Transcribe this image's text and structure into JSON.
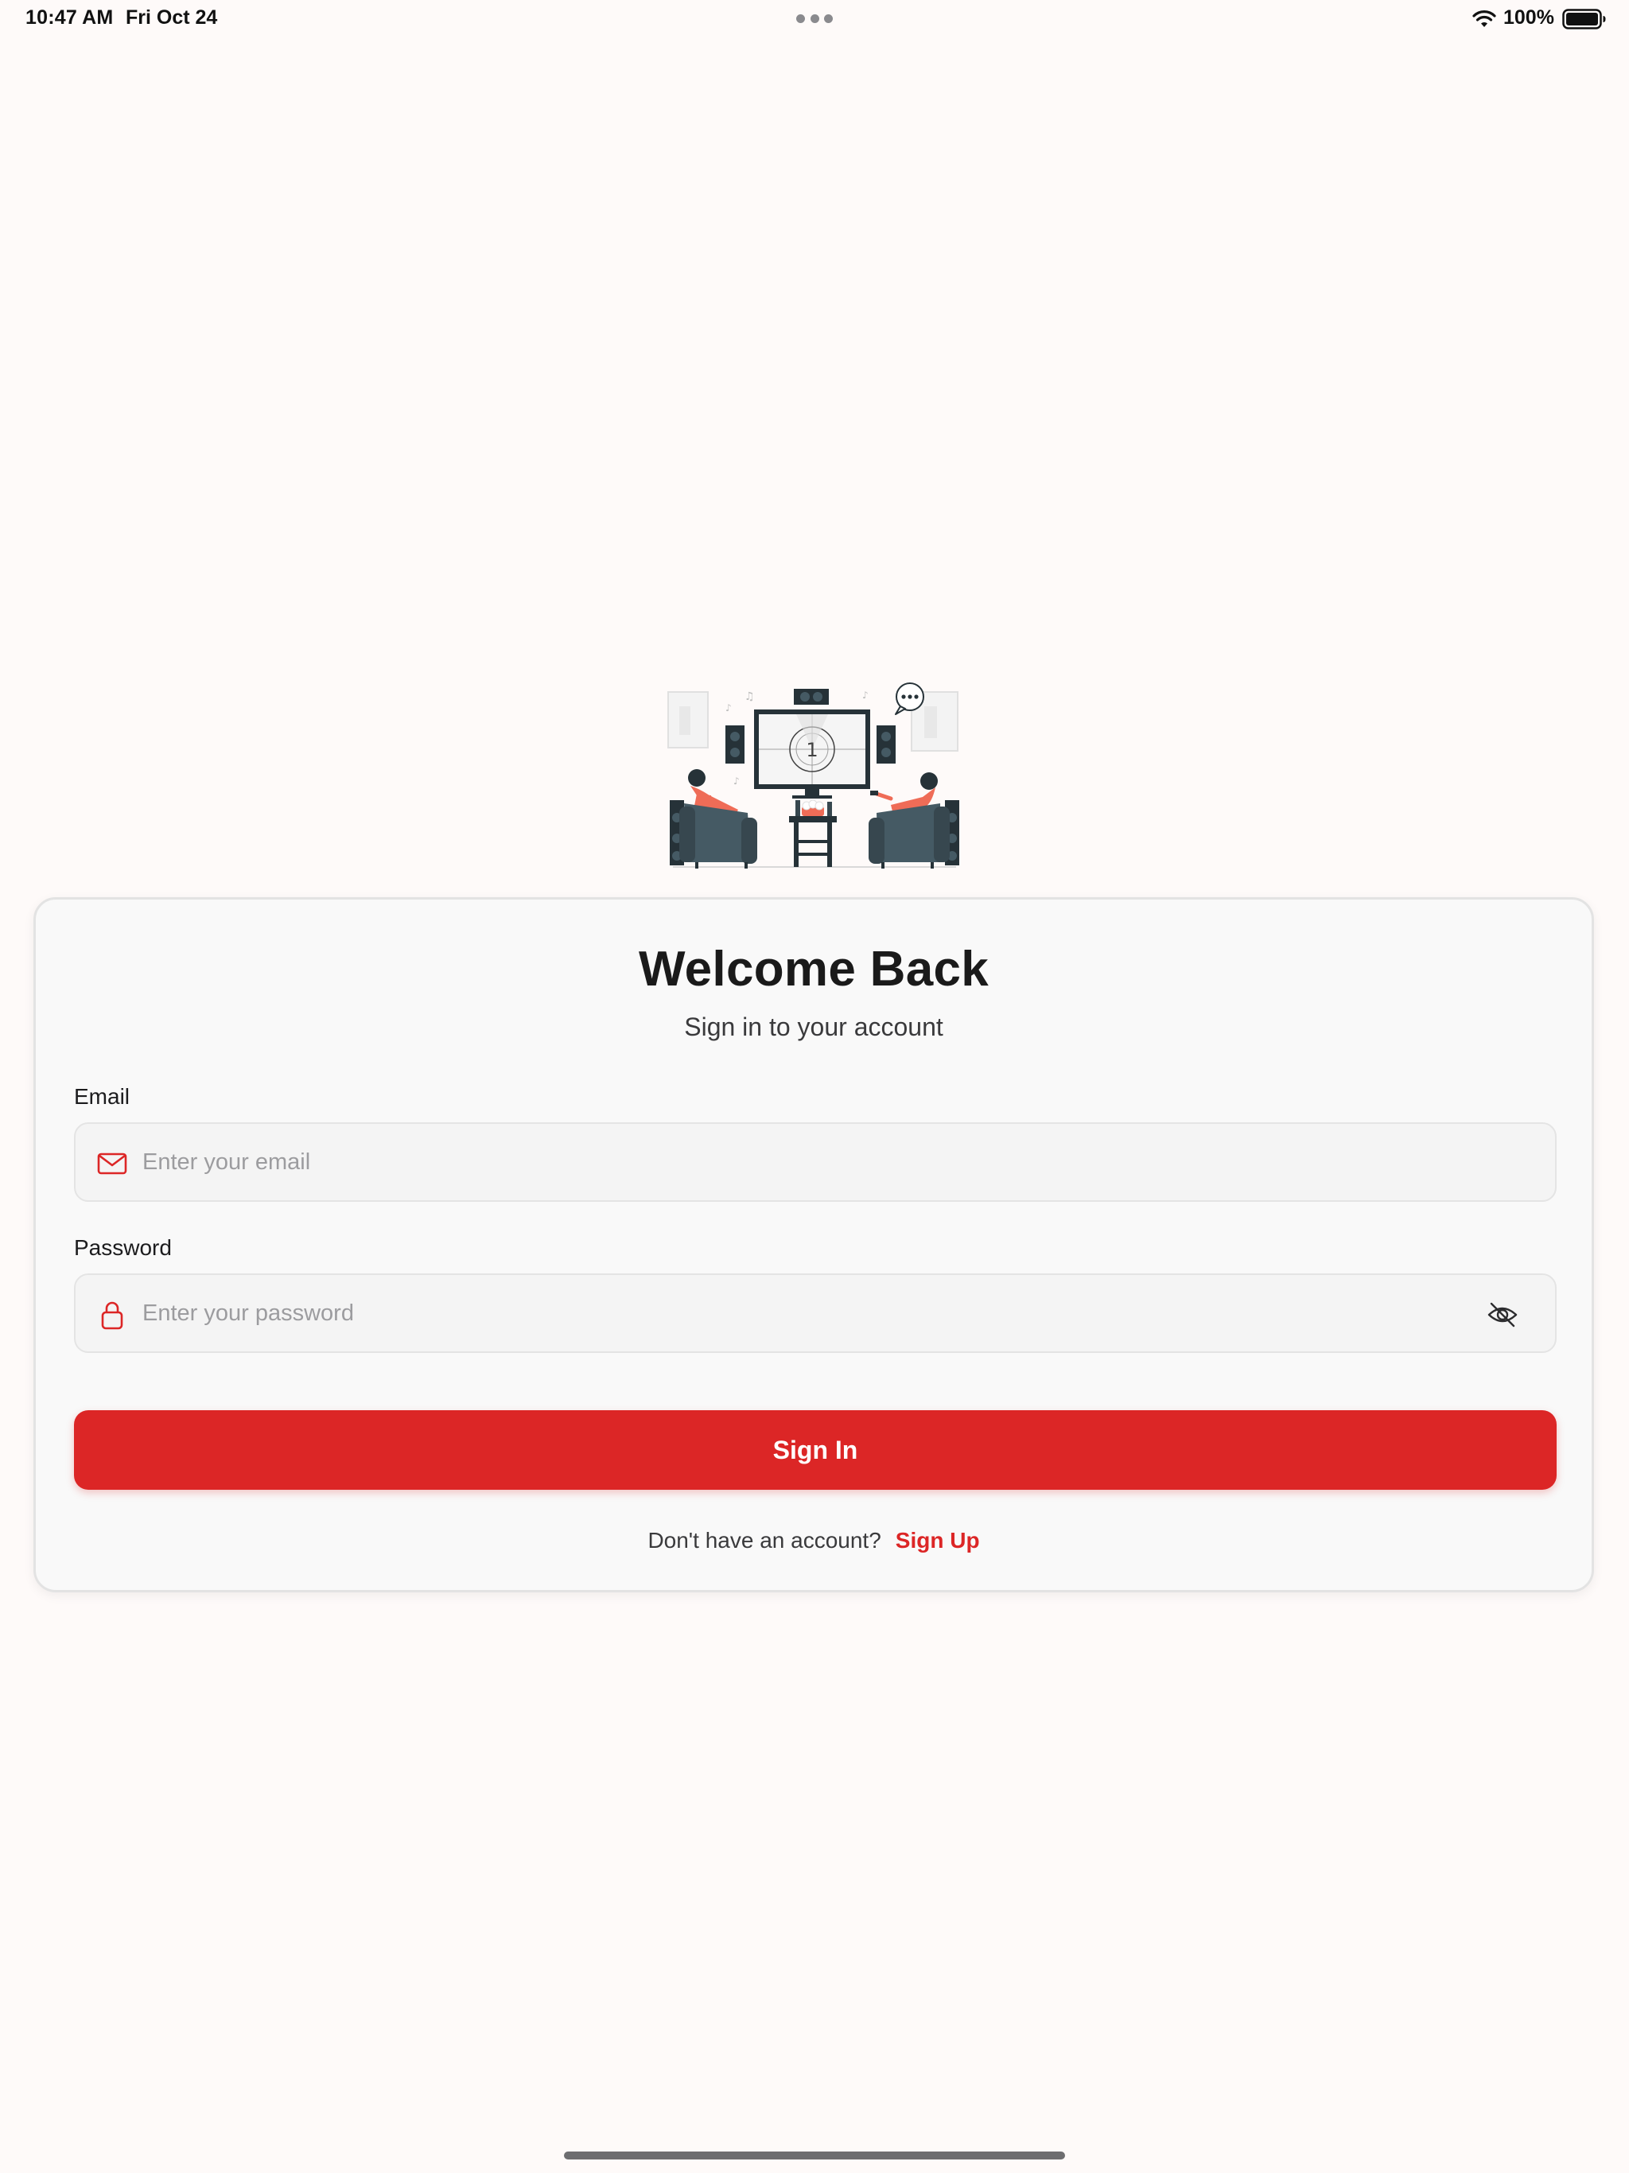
{
  "status_bar": {
    "time": "10:47 AM",
    "date": "Fri Oct 24",
    "battery": "100%",
    "icons": [
      "wifi-icon",
      "battery-icon",
      "multitasking-dots-icon"
    ]
  },
  "illustration": {
    "icon": "home-theater-illustration",
    "screen_number": "1"
  },
  "login": {
    "title": "Welcome Back",
    "subtitle": "Sign in to your account",
    "email": {
      "label": "Email",
      "placeholder": "Enter your email",
      "value": "",
      "icon": "mail-icon"
    },
    "password": {
      "label": "Password",
      "placeholder": "Enter your password",
      "value": "",
      "icon": "lock-icon",
      "toggle_icon": "eye-off-icon"
    },
    "signin_label": "Sign In",
    "signup_prompt": "Don't have an account?",
    "signup_label": "Sign Up"
  },
  "colors": {
    "accent": "#dc2626",
    "background": "#fefaf9",
    "card": "#f9f9f9",
    "input_bg": "#f4f4f4"
  }
}
